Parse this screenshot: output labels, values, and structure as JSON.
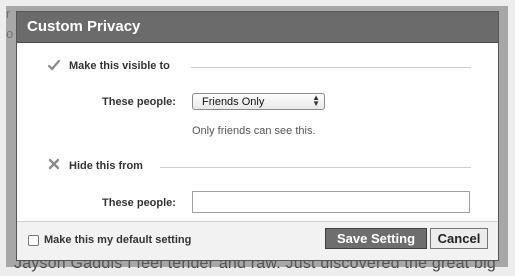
{
  "background": {
    "top_left_char": "r",
    "left_char": "o",
    "bottom_text": "Jayson Gaddis I feel tender and raw. Just discovered the great big"
  },
  "dialog": {
    "title": "Custom Privacy",
    "visible_section": {
      "title": "Make this visible to",
      "icon": "check-icon",
      "field_label": "These people:",
      "select_value": "Friends Only",
      "hint": "Only friends can see this."
    },
    "hide_section": {
      "title": "Hide this from",
      "icon": "x-icon",
      "field_label": "These people:",
      "input_value": ""
    },
    "footer": {
      "default_label": "Make this my default setting",
      "default_checked": false,
      "save_label": "Save Setting",
      "cancel_label": "Cancel"
    }
  },
  "colors": {
    "header": "#6b6b6b",
    "save_button": "#6e6e6e"
  }
}
